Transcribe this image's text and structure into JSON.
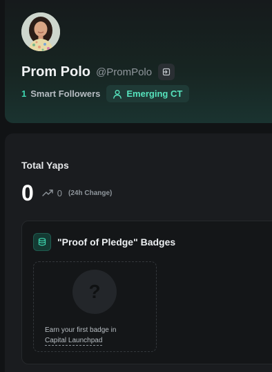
{
  "profile": {
    "display_name": "Prom Polo",
    "handle": "@PromPolo",
    "smart_followers_count": "1",
    "smart_followers_label": "Smart Followers",
    "tier_badge": "Emerging CT",
    "icons": {
      "link": "sign-in-icon",
      "tier": "user-icon"
    }
  },
  "yaps": {
    "title": "Total Yaps",
    "value": "0",
    "change_value": "0",
    "change_label": "(24h Change)",
    "trend_icon": "trending-up-icon"
  },
  "badges": {
    "title": "\"Proof of Pledge\" Badges",
    "icon": "coins-icon",
    "empty_text": "Earn your first badge in",
    "empty_link": "Capital Launchpad",
    "placeholder_icon": "question-mark-icon"
  },
  "colors": {
    "accent": "#3ed6b0",
    "background": "#111315",
    "card": "#1a1c1f"
  }
}
